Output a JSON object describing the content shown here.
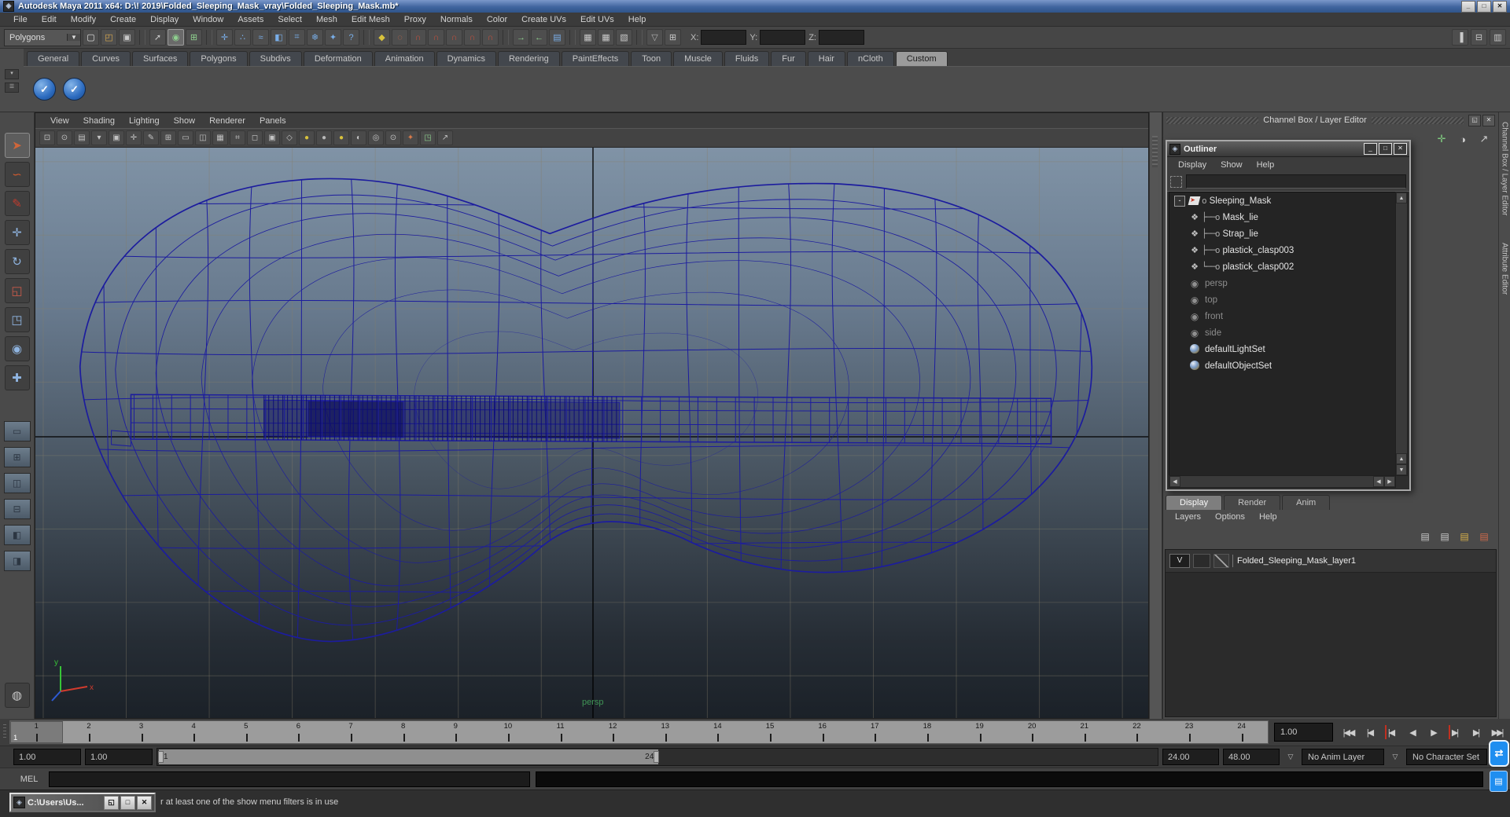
{
  "window": {
    "title": "Autodesk Maya 2011 x64: D:\\! 2019\\Folded_Sleeping_Mask_vray\\Folded_Sleeping_Mask.mb*",
    "buttons": [
      {
        "name": "minimize-button",
        "glyph": "_"
      },
      {
        "name": "maximize-button",
        "glyph": "□"
      },
      {
        "name": "close-button",
        "glyph": "✕"
      }
    ]
  },
  "menubar": {
    "items": [
      "File",
      "Edit",
      "Modify",
      "Create",
      "Display",
      "Window",
      "Assets",
      "Select",
      "Mesh",
      "Edit Mesh",
      "Proxy",
      "Normals",
      "Color",
      "Create UVs",
      "Edit UVs",
      "Help"
    ]
  },
  "statusline": {
    "mode_dropdown": "Polygons",
    "dropdown_arrow": "▼",
    "icons": [
      {
        "name": "new-scene-icon",
        "glyph": "▢",
        "color": "#e2e2e2"
      },
      {
        "name": "open-scene-icon",
        "glyph": "◰",
        "color": "#d8a84e"
      },
      {
        "name": "save-scene-icon",
        "glyph": "▣",
        "color": "#c9c9c9"
      },
      {
        "name": "separator",
        "cls": "sep"
      },
      {
        "name": "select-hierarchy-icon",
        "glyph": "➚",
        "color": "#c9c9c9"
      },
      {
        "name": "select-object-icon",
        "glyph": "◉",
        "color": "#8fd18f",
        "cls": "active"
      },
      {
        "name": "select-component-icon",
        "glyph": "⊞",
        "color": "#8fd18f"
      },
      {
        "name": "separator",
        "cls": "sep"
      },
      {
        "name": "select-handles-icon",
        "glyph": "✛",
        "color": "#79aee8"
      },
      {
        "name": "select-points-icon",
        "glyph": "∴",
        "color": "#79aee8"
      },
      {
        "name": "select-curves-icon",
        "glyph": "≈",
        "color": "#79aee8"
      },
      {
        "name": "select-surfaces-icon",
        "glyph": "◧",
        "color": "#79aee8"
      },
      {
        "name": "select-deformations-icon",
        "glyph": "⌗",
        "color": "#79aee8"
      },
      {
        "name": "select-dynamics-icon",
        "glyph": "❄",
        "color": "#79aee8"
      },
      {
        "name": "select-rendering-icon",
        "glyph": "✦",
        "color": "#79aee8"
      },
      {
        "name": "select-misc-icon",
        "glyph": "?",
        "color": "#79aee8"
      },
      {
        "name": "separator",
        "cls": "sep"
      },
      {
        "name": "lock-selection-icon",
        "glyph": "◆",
        "color": "#d8c23c"
      },
      {
        "name": "highlight-selection-icon",
        "glyph": "◌",
        "color": "#cf6a4a"
      },
      {
        "name": "snap-grid-icon",
        "glyph": "∩",
        "color": "#c4503c"
      },
      {
        "name": "snap-curve-icon",
        "glyph": "∩",
        "color": "#c4503c"
      },
      {
        "name": "snap-point-icon",
        "glyph": "∩",
        "color": "#c4503c"
      },
      {
        "name": "snap-plane-icon",
        "glyph": "∩",
        "color": "#c4503c"
      },
      {
        "name": "snap-view-icon",
        "glyph": "∩",
        "color": "#c4503c"
      },
      {
        "name": "separator",
        "cls": "sep"
      },
      {
        "name": "input-connections-icon",
        "glyph": "→",
        "color": "#8fd18f"
      },
      {
        "name": "output-connections-icon",
        "glyph": "←",
        "color": "#8fd18f"
      },
      {
        "name": "construction-history-icon",
        "glyph": "▤",
        "color": "#79aee8"
      },
      {
        "name": "separator",
        "cls": "sep"
      },
      {
        "name": "render-current-frame-icon",
        "glyph": "▦",
        "color": "#c9c9c9"
      },
      {
        "name": "ipr-render-icon",
        "glyph": "▦",
        "color": "#c9c9c9"
      },
      {
        "name": "render-settings-icon",
        "glyph": "▧",
        "color": "#c9c9c9"
      },
      {
        "name": "separator",
        "cls": "sep"
      },
      {
        "name": "collapse-arrow-icon",
        "glyph": "▽",
        "color": "#b0b0b0"
      },
      {
        "name": "quick-layout-icon",
        "glyph": "⊞",
        "color": "#c9c9c9"
      }
    ],
    "coords": [
      {
        "label": "X:",
        "name": "x-coordinate-field"
      },
      {
        "label": "Y:",
        "name": "y-coordinate-field"
      },
      {
        "label": "Z:",
        "name": "z-coordinate-field"
      }
    ],
    "right_icons": [
      {
        "name": "toggle-channel-box-icon",
        "glyph": "▐",
        "color": "#c9c9c9"
      },
      {
        "name": "toggle-tool-settings-icon",
        "glyph": "⊟",
        "color": "#c9c9c9"
      },
      {
        "name": "toggle-attribute-editor-icon",
        "glyph": "▥",
        "color": "#c9c9c9"
      }
    ]
  },
  "shelf": {
    "tab_toggle_glyph": "▾",
    "menu_glyph": "☰",
    "tabs": [
      {
        "label": "General"
      },
      {
        "label": "Curves"
      },
      {
        "label": "Surfaces"
      },
      {
        "label": "Polygons"
      },
      {
        "label": "Subdivs"
      },
      {
        "label": "Deformation"
      },
      {
        "label": "Animation"
      },
      {
        "label": "Dynamics"
      },
      {
        "label": "Rendering"
      },
      {
        "label": "PaintEffects"
      },
      {
        "label": "Toon"
      },
      {
        "label": "Muscle"
      },
      {
        "label": "Fluids"
      },
      {
        "label": "Fur"
      },
      {
        "label": "Hair"
      },
      {
        "label": "nCloth"
      },
      {
        "label": "Custom",
        "cls": "active"
      }
    ],
    "buttons": [
      {
        "name": "custom-shelf-button-1",
        "glyph": "✓"
      },
      {
        "name": "custom-shelf-button-2",
        "glyph": "✓"
      }
    ]
  },
  "toolbox": {
    "tools": [
      {
        "name": "select-tool",
        "glyph": "➤",
        "color": "#d0663a",
        "cls": "active"
      },
      {
        "name": "lasso-select-tool",
        "glyph": "∽",
        "color": "#cf5a2e"
      },
      {
        "name": "paint-select-tool",
        "glyph": "✎",
        "color": "#c23b2e"
      },
      {
        "name": "move-tool",
        "glyph": "✛",
        "color": "#8fb4e0"
      },
      {
        "name": "rotate-tool",
        "glyph": "↻",
        "color": "#8fb4e0"
      },
      {
        "name": "scale-tool",
        "glyph": "◱",
        "color": "#c95a4a"
      },
      {
        "name": "universal-manipulator-tool",
        "glyph": "◳",
        "color": "#8fb4e0"
      },
      {
        "name": "soft-modification-tool",
        "glyph": "◉",
        "color": "#8fb4e0"
      },
      {
        "name": "show-manipulator-tool",
        "glyph": "✚",
        "color": "#8fb4e0"
      }
    ],
    "layouts": [
      {
        "name": "single-pane-layout-button",
        "glyph": "▭"
      },
      {
        "name": "four-view-layout-button",
        "glyph": "⊞"
      },
      {
        "name": "two-pane-side-layout-button",
        "glyph": "◫"
      },
      {
        "name": "two-pane-stacked-layout-button",
        "glyph": "⊟"
      },
      {
        "name": "three-pane-layout-button",
        "glyph": "◧"
      },
      {
        "name": "outliner-persp-layout-button",
        "glyph": "◨"
      }
    ],
    "bottom_tool": {
      "name": "paint-effects-panel-button",
      "glyph": "◍"
    }
  },
  "viewport": {
    "menus": [
      "View",
      "Shading",
      "Lighting",
      "Show",
      "Renderer",
      "Panels"
    ],
    "toolbar_icons": [
      {
        "name": "select-camera-icon",
        "glyph": "⊡"
      },
      {
        "name": "lock-camera-icon",
        "glyph": "⊙"
      },
      {
        "name": "camera-attributes-icon",
        "glyph": "▤"
      },
      {
        "name": "bookmarks-icon",
        "glyph": "▾"
      },
      {
        "name": "image-plane-icon",
        "glyph": "▣"
      },
      {
        "name": "2d-pan-zoom-icon",
        "glyph": "✛"
      },
      {
        "name": "grease-pencil-icon",
        "glyph": "✎"
      },
      {
        "name": "grid-icon",
        "glyph": "⊞"
      },
      {
        "name": "film-gate-icon",
        "glyph": "▭"
      },
      {
        "name": "resolution-gate-icon",
        "glyph": "◫"
      },
      {
        "name": "gate-mask-icon",
        "glyph": "▦"
      },
      {
        "name": "field-chart-icon",
        "glyph": "⌗"
      },
      {
        "name": "safe-action-icon",
        "glyph": "◻"
      },
      {
        "name": "safe-title-icon",
        "glyph": "▣"
      },
      {
        "name": "wireframe-mode-icon",
        "glyph": "◇"
      },
      {
        "name": "shaded-mode-icon",
        "glyph": "●",
        "color": "#d8c23c"
      },
      {
        "name": "textured-mode-icon",
        "glyph": "●",
        "color": "#b8b8b8"
      },
      {
        "name": "use-all-lights-icon",
        "glyph": "●",
        "color": "#d8c23c"
      },
      {
        "name": "shadows-icon",
        "glyph": "◐"
      },
      {
        "name": "xray-icon",
        "glyph": "◎"
      },
      {
        "name": "isolate-select-icon",
        "glyph": "⊙"
      },
      {
        "name": "plugin-shelf-icon",
        "glyph": "✦",
        "color": "#d87a4a"
      },
      {
        "name": "snapshot-icon",
        "glyph": "◳",
        "color": "#8fd18f"
      },
      {
        "name": "share-icon",
        "glyph": "↗"
      }
    ],
    "camera_label": "persp",
    "axis_labels": {
      "x": "x",
      "y": "y"
    }
  },
  "right_panel": {
    "header": "Channel Box / Layer Editor",
    "header_buttons": [
      {
        "name": "restore-panel-button",
        "glyph": "◱"
      },
      {
        "name": "close-panel-button",
        "glyph": "✕"
      }
    ],
    "icons": [
      {
        "name": "move-axis-icon",
        "glyph": "✛",
        "color": "#7fc97f"
      },
      {
        "name": "speed-ramp-icon",
        "glyph": "◑",
        "color": "#cfcfcf"
      },
      {
        "name": "hyperbolic-arrow-icon",
        "glyph": "↗",
        "color": "#cfcfcf"
      }
    ],
    "vertical_tabs": [
      {
        "label": "Channel Box / Layer Editor"
      },
      {
        "label": "Attribute Editor"
      }
    ]
  },
  "outliner": {
    "title": "Outliner",
    "window_buttons": [
      {
        "name": "minimize-button",
        "glyph": "_"
      },
      {
        "name": "maximize-button",
        "glyph": "□"
      },
      {
        "name": "close-button",
        "glyph": "✕"
      }
    ],
    "menus": [
      "Display",
      "Show",
      "Help"
    ],
    "search_value": "",
    "items": [
      {
        "label": "Sleeping_Mask",
        "type": "transform",
        "expander": "-",
        "conn": "o",
        "icon_name": "transform-icon"
      },
      {
        "label": "Mask_lie",
        "type": "mesh",
        "conn": "├──o",
        "icon_name": "mesh-icon"
      },
      {
        "label": "Strap_lie",
        "type": "mesh",
        "conn": "├──o",
        "icon_name": "mesh-icon"
      },
      {
        "label": "plastick_clasp003",
        "type": "mesh",
        "conn": "├──o",
        "icon_name": "mesh-icon"
      },
      {
        "label": "plastick_clasp002",
        "type": "mesh",
        "conn": "└──o",
        "icon_name": "mesh-icon"
      },
      {
        "label": "persp",
        "type": "camera",
        "cls": "muted",
        "icon_name": "camera-icon"
      },
      {
        "label": "top",
        "type": "camera",
        "cls": "muted",
        "icon_name": "camera-icon"
      },
      {
        "label": "front",
        "type": "camera",
        "cls": "muted",
        "icon_name": "camera-icon"
      },
      {
        "label": "side",
        "type": "camera",
        "cls": "muted",
        "icon_name": "camera-icon"
      },
      {
        "label": "defaultLightSet",
        "type": "set",
        "icon_name": "set-icon"
      },
      {
        "label": "defaultObjectSet",
        "type": "set",
        "icon_name": "set-icon"
      }
    ]
  },
  "layer_editor": {
    "tabs": [
      {
        "label": "Display",
        "cls": "active"
      },
      {
        "label": "Render"
      },
      {
        "label": "Anim"
      }
    ],
    "menus": [
      "Layers",
      "Options",
      "Help"
    ],
    "icons": [
      {
        "name": "layer-move-up-icon",
        "glyph": "▤",
        "color": "#c9c9c9"
      },
      {
        "name": "create-empty-layer-icon",
        "glyph": "▤",
        "color": "#c9c9c9"
      },
      {
        "name": "create-layer-icon",
        "glyph": "▤",
        "color": "#d8b04a"
      },
      {
        "name": "create-layer-from-selected-icon",
        "glyph": "▤",
        "color": "#cf6a4a"
      }
    ],
    "layer": {
      "visibility": "V",
      "name": "Folded_Sleeping_Mask_layer1"
    }
  },
  "timeline": {
    "frames": [
      {
        "n": "1",
        "cls": "current",
        "cur": "1"
      },
      {
        "n": "2"
      },
      {
        "n": "3"
      },
      {
        "n": "4"
      },
      {
        "n": "5"
      },
      {
        "n": "6"
      },
      {
        "n": "7"
      },
      {
        "n": "8"
      },
      {
        "n": "9"
      },
      {
        "n": "10"
      },
      {
        "n": "11"
      },
      {
        "n": "12"
      },
      {
        "n": "13"
      },
      {
        "n": "14"
      },
      {
        "n": "15"
      },
      {
        "n": "16"
      },
      {
        "n": "17"
      },
      {
        "n": "18"
      },
      {
        "n": "19"
      },
      {
        "n": "20"
      },
      {
        "n": "21"
      },
      {
        "n": "22"
      },
      {
        "n": "23"
      },
      {
        "n": "24"
      }
    ],
    "current_time_field": "1.00",
    "playback": [
      {
        "name": "go-to-start-button",
        "glyph": "|◀◀"
      },
      {
        "name": "step-back-frame-button",
        "glyph": "|◀"
      },
      {
        "name": "step-back-key-button",
        "glyph": "|◀",
        "cls": "key"
      },
      {
        "name": "play-backwards-button",
        "glyph": "◀"
      },
      {
        "name": "play-forwards-button",
        "glyph": "▶"
      },
      {
        "name": "step-forward-key-button",
        "glyph": "▶|",
        "cls": "key"
      },
      {
        "name": "step-forward-frame-button",
        "glyph": "▶|"
      },
      {
        "name": "go-to-end-button",
        "glyph": "▶▶|"
      }
    ]
  },
  "range_slider": {
    "anim_start": "1.00",
    "playback_start": "1.00",
    "bar_start_label": "1",
    "bar_end_label": "24",
    "playback_end": "24.00",
    "anim_end": "48.00",
    "dropdown_arrow": "▽",
    "anim_layer": "No Anim Layer",
    "character_set": "No Character Set",
    "key_glyph": "○—"
  },
  "command_line": {
    "label": "MEL",
    "input_value": ""
  },
  "help_line": {
    "text": "r at least one of the show menu filters is in use"
  },
  "mini_window": {
    "title": "C:\\Users\\Us...",
    "buttons": [
      {
        "name": "restore-button",
        "glyph": "◱"
      },
      {
        "name": "maximize-button",
        "glyph": "□"
      },
      {
        "name": "close-button",
        "glyph": "✕"
      }
    ]
  },
  "overlay_icons": [
    {
      "name": "teamviewer-icon",
      "glyph": "⇄"
    },
    {
      "name": "notification-icon",
      "glyph": "▤"
    }
  ],
  "colors": {
    "wireframe": "#1c1c9e",
    "wireframe_dense": "#0d0d78",
    "titlebar_blue": "#40659f",
    "viewport_top": "#8093a6",
    "viewport_bottom": "#1b2128",
    "persp_label_green": "#3f9455",
    "selection_blue": "#79aee8",
    "magnet_red": "#c4503c",
    "grid_line": "#857d69"
  }
}
